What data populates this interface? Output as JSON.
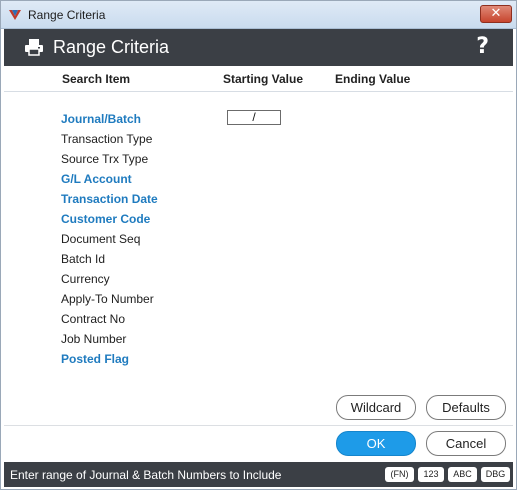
{
  "window": {
    "title": "Range Criteria"
  },
  "header": {
    "title": "Range Criteria",
    "help_glyph": "?"
  },
  "columns": {
    "search_item": "Search Item",
    "starting_value": "Starting Value",
    "ending_value": "Ending Value"
  },
  "items": [
    {
      "label": "Journal/Batch",
      "bold": true
    },
    {
      "label": "Transaction Type",
      "bold": false
    },
    {
      "label": "Source Trx Type",
      "bold": false
    },
    {
      "label": "G/L Account",
      "bold": true
    },
    {
      "label": "Transaction Date",
      "bold": true
    },
    {
      "label": "Customer Code",
      "bold": true
    },
    {
      "label": "Document Seq",
      "bold": false
    },
    {
      "label": "Batch Id",
      "bold": false
    },
    {
      "label": "Currency",
      "bold": false
    },
    {
      "label": "Apply-To Number",
      "bold": false
    },
    {
      "label": "Contract No",
      "bold": false
    },
    {
      "label": "Job Number",
      "bold": false
    },
    {
      "label": "Posted Flag",
      "bold": true
    }
  ],
  "journal_batch_start": "/",
  "buttons": {
    "wildcard": "Wildcard",
    "defaults": "Defaults",
    "ok": "OK",
    "cancel": "Cancel"
  },
  "status": {
    "text": "Enter range of Journal & Batch Numbers to Include",
    "tags": {
      "fn": "(FN)",
      "num": "123",
      "abc": "ABC",
      "dbg": "DBG"
    }
  },
  "colors": {
    "accent": "#1f7bbf",
    "header_bg": "#3b3f45",
    "ok_button": "#1e9be8"
  }
}
